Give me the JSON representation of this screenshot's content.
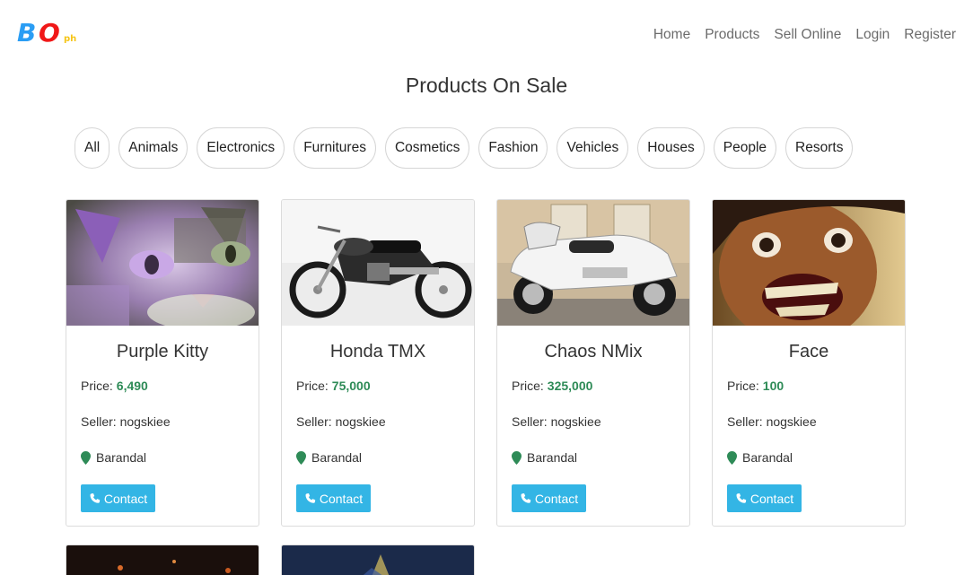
{
  "brand": {
    "logo_b": "B",
    "logo_o": "O",
    "logo_ph": "ph"
  },
  "nav": {
    "items": [
      {
        "label": "Home"
      },
      {
        "label": "Products"
      },
      {
        "label": "Sell Online"
      },
      {
        "label": "Login"
      },
      {
        "label": "Register"
      }
    ]
  },
  "page_title": "Products On Sale",
  "categories": [
    "All",
    "Animals",
    "Electronics",
    "Furnitures",
    "Cosmetics",
    "Fashion",
    "Vehicles",
    "Houses",
    "People",
    "Resorts"
  ],
  "labels": {
    "price": "Price:",
    "seller_prefix": "Seller:",
    "contact": "Contact"
  },
  "products": [
    {
      "title": "Purple Kitty",
      "price": "6,490",
      "seller": "Seller: nogskiee",
      "location": "Barandal",
      "image": "purple-cat-photo"
    },
    {
      "title": "Honda TMX",
      "price": "75,000",
      "seller": "Seller: nogskiee",
      "location": "Barandal",
      "image": "motorcycle-photo"
    },
    {
      "title": "Chaos NMix",
      "price": "325,000",
      "seller": "Seller: nogskiee",
      "location": "Barandal",
      "image": "touring-motorcycle-photo"
    },
    {
      "title": "Face",
      "price": "100",
      "seller": "Seller: nogskiee",
      "location": "Barandal",
      "image": "grinning-face-photo"
    }
  ],
  "colors": {
    "accent": "#33b5e5",
    "price": "#2e8b57",
    "pin": "#2e8b57"
  },
  "icons": {
    "location": "map-marker-icon",
    "contact": "phone-icon"
  }
}
